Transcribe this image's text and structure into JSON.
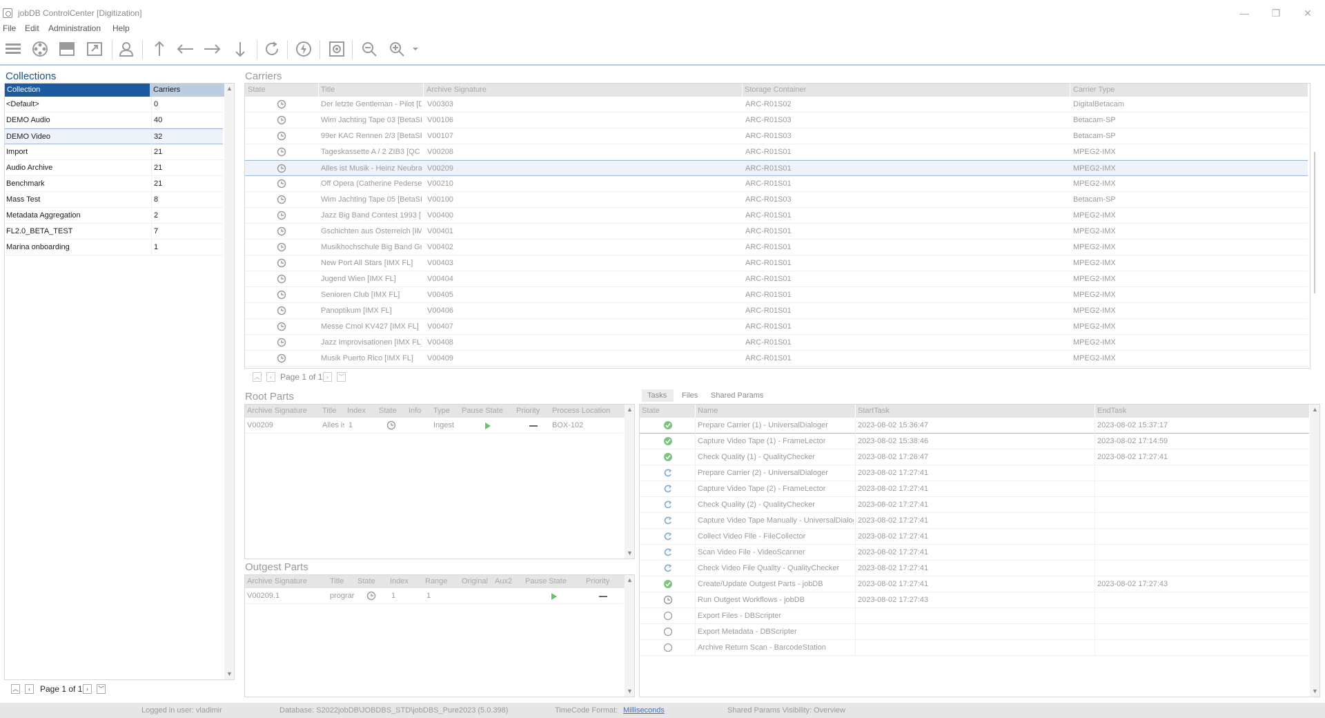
{
  "window": {
    "title": "jobDB ControlCenter [Digitization]",
    "controls": [
      "—",
      "❐",
      "✕"
    ]
  },
  "menu": [
    "File",
    "Edit",
    "Administration",
    "Help"
  ],
  "collections": {
    "title": "Collections",
    "headers": [
      "Collection",
      "Carriers"
    ],
    "rows": [
      {
        "name": "<Default>",
        "count": "0"
      },
      {
        "name": "DEMO Audio",
        "count": "40"
      },
      {
        "name": "DEMO Video",
        "count": "32"
      },
      {
        "name": "Import",
        "count": "21"
      },
      {
        "name": "Audio Archive",
        "count": "21"
      },
      {
        "name": "Benchmark",
        "count": "21"
      },
      {
        "name": "Mass Test",
        "count": "8"
      },
      {
        "name": "Metadata Aggregation",
        "count": "2"
      },
      {
        "name": "FL2.0_BETA_TEST",
        "count": "7"
      },
      {
        "name": "Marina onboarding",
        "count": "1"
      }
    ],
    "selected_index": 2,
    "pager": "Page 1 of 1"
  },
  "carriers": {
    "title": "Carriers",
    "headers": [
      "State",
      "Title",
      "Archive Signature",
      "Storage Container",
      "Carrier Type"
    ],
    "rows": [
      {
        "title": "Der letzte Gentleman - Pilot [Di",
        "sig": "V00303",
        "container": "ARC-R01S02",
        "type": "DigitalBetacam"
      },
      {
        "title": "Wim Jachting Tape 03 [BetaSP",
        "sig": "V00106",
        "container": "ARC-R01S03",
        "type": "Betacam-SP"
      },
      {
        "title": "99er KAC Rennen 2/3 [BetaSP",
        "sig": "V00107",
        "container": "ARC-R01S03",
        "type": "Betacam-SP"
      },
      {
        "title": " Tageskassette A / 2  ZIB3 [QC",
        "sig": "V00208",
        "container": "ARC-R01S01",
        "type": "MPEG2-IMX"
      },
      {
        "title": "Alles ist Musik - Heinz Neubranc",
        "sig": "V00209",
        "container": "ARC-R01S01",
        "type": "MPEG2-IMX"
      },
      {
        "title": "Off Opera (Catherine Pedersen",
        "sig": "V00210",
        "container": "ARC-R01S01",
        "type": "MPEG2-IMX"
      },
      {
        "title": "Wim Jachting Tape 05 [BetaSP",
        "sig": "V00100",
        "container": "ARC-R01S03",
        "type": "Betacam-SP"
      },
      {
        "title": "Jazz Big Band Contest 1993 [IM",
        "sig": "V00400",
        "container": "ARC-R01S01",
        "type": "MPEG2-IMX"
      },
      {
        "title": "Gschichten aus Österreich [IMX",
        "sig": "V00401",
        "container": "ARC-R01S01",
        "type": "MPEG2-IMX"
      },
      {
        "title": "Musikhochschule Big Band Graz",
        "sig": "V00402",
        "container": "ARC-R01S01",
        "type": "MPEG2-IMX"
      },
      {
        "title": "New Port All Stars [IMX FL]",
        "sig": "V00403",
        "container": "ARC-R01S01",
        "type": "MPEG2-IMX"
      },
      {
        "title": "Jugend Wien [IMX FL]",
        "sig": "V00404",
        "container": "ARC-R01S01",
        "type": "MPEG2-IMX"
      },
      {
        "title": "Senioren Club [IMX FL]",
        "sig": "V00405",
        "container": "ARC-R01S01",
        "type": "MPEG2-IMX"
      },
      {
        "title": "Panoptikum [IMX FL]",
        "sig": "V00406",
        "container": "ARC-R01S01",
        "type": "MPEG2-IMX"
      },
      {
        "title": "Messe Cmol KV427 [IMX FL]",
        "sig": "V00407",
        "container": "ARC-R01S01",
        "type": "MPEG2-IMX"
      },
      {
        "title": "Jazz Improvisationen [IMX FL]",
        "sig": "V00408",
        "container": "ARC-R01S01",
        "type": "MPEG2-IMX"
      },
      {
        "title": "Musik Puerto Rico [IMX FL]",
        "sig": "V00409",
        "container": "ARC-R01S01",
        "type": "MPEG2-IMX"
      }
    ],
    "selected_index": 4,
    "pager": "Page 1 of 1"
  },
  "root_parts": {
    "title": "Root Parts",
    "headers": [
      "Archive Signature",
      "Title",
      "Index",
      "State",
      "Info",
      "Type",
      "Pause State",
      "Priority",
      "Process Location"
    ],
    "row": {
      "sig": "V00209",
      "title": "Alles is",
      "index": "1",
      "type": "Ingest",
      "location": "BOX-102"
    }
  },
  "outgest_parts": {
    "title": "Outgest Parts",
    "headers": [
      "Archive Signature",
      "Title",
      "State",
      "Index",
      "Range",
      "Original",
      "Aux2",
      "Pause State",
      "Priority"
    ],
    "row": {
      "sig": "V00209.1",
      "title": "prograr",
      "index": "1",
      "range": "1"
    }
  },
  "tasks": {
    "tabs": [
      "Tasks",
      "Files",
      "Shared Params"
    ],
    "headers": [
      "State",
      "Name",
      "StartTask",
      "EndTask"
    ],
    "rows": [
      {
        "state": "done",
        "name": "Prepare Carrier (1) - UniversalDialoger",
        "start": "2023-08-02 15:36:47",
        "end": "2023-08-02 15:37:17"
      },
      {
        "state": "done",
        "name": "Capture Video Tape (1) - FrameLector",
        "start": "2023-08-02 15:38:46",
        "end": "2023-08-02 17:14:59"
      },
      {
        "state": "done",
        "name": "Check Quality (1) - QualityChecker",
        "start": "2023-08-02 17:26:47",
        "end": "2023-08-02 17:27:41"
      },
      {
        "state": "redo",
        "name": "Prepare Carrier (2) - UniversalDialoger",
        "start": "2023-08-02 17:27:41",
        "end": ""
      },
      {
        "state": "redo",
        "name": "Capture Video Tape (2) - FrameLector",
        "start": "2023-08-02 17:27:41",
        "end": ""
      },
      {
        "state": "redo",
        "name": "Check Quality (2) - QualityChecker",
        "start": "2023-08-02 17:27:41",
        "end": ""
      },
      {
        "state": "redo",
        "name": "Capture Video Tape Manually - UniversalDialoge",
        "start": "2023-08-02 17:27:41",
        "end": ""
      },
      {
        "state": "redo",
        "name": "Collect Video File - FileCollector",
        "start": "2023-08-02 17:27:41",
        "end": ""
      },
      {
        "state": "redo",
        "name": "Scan Video File - VideoScanner",
        "start": "2023-08-02 17:27:41",
        "end": ""
      },
      {
        "state": "redo",
        "name": "Check Video File Quality - QualityChecker",
        "start": "2023-08-02 17:27:41",
        "end": ""
      },
      {
        "state": "done",
        "name": "Create/Update Outgest Parts - jobDB",
        "start": "2023-08-02 17:27:41",
        "end": "2023-08-02 17:27:43"
      },
      {
        "state": "running",
        "name": "Run Outgest Workflows - jobDB",
        "start": "2023-08-02 17:27:43",
        "end": ""
      },
      {
        "state": "pending",
        "name": "Export Files - DBScripter",
        "start": "",
        "end": ""
      },
      {
        "state": "pending",
        "name": "Export Metadata - DBScripter",
        "start": "",
        "end": ""
      },
      {
        "state": "pending",
        "name": "Archive Return Scan - BarcodeStation",
        "start": "",
        "end": ""
      }
    ]
  },
  "status": {
    "user": "Logged in user: vladimir",
    "database": "Database: S2022jobDB\\JOBDBS_STD\\jobDBS_Pure2023 (5.0.398)",
    "timecode_label": "TimeCode Format:",
    "timecode_value": "Milliseconds",
    "shared": "Shared Params Visibility: Overview"
  },
  "colors": {
    "accent": "#1e5b9e",
    "selection": "#eef3fa",
    "done": "#4caf50",
    "redo": "#6b9bd1",
    "play": "#4caf50"
  }
}
